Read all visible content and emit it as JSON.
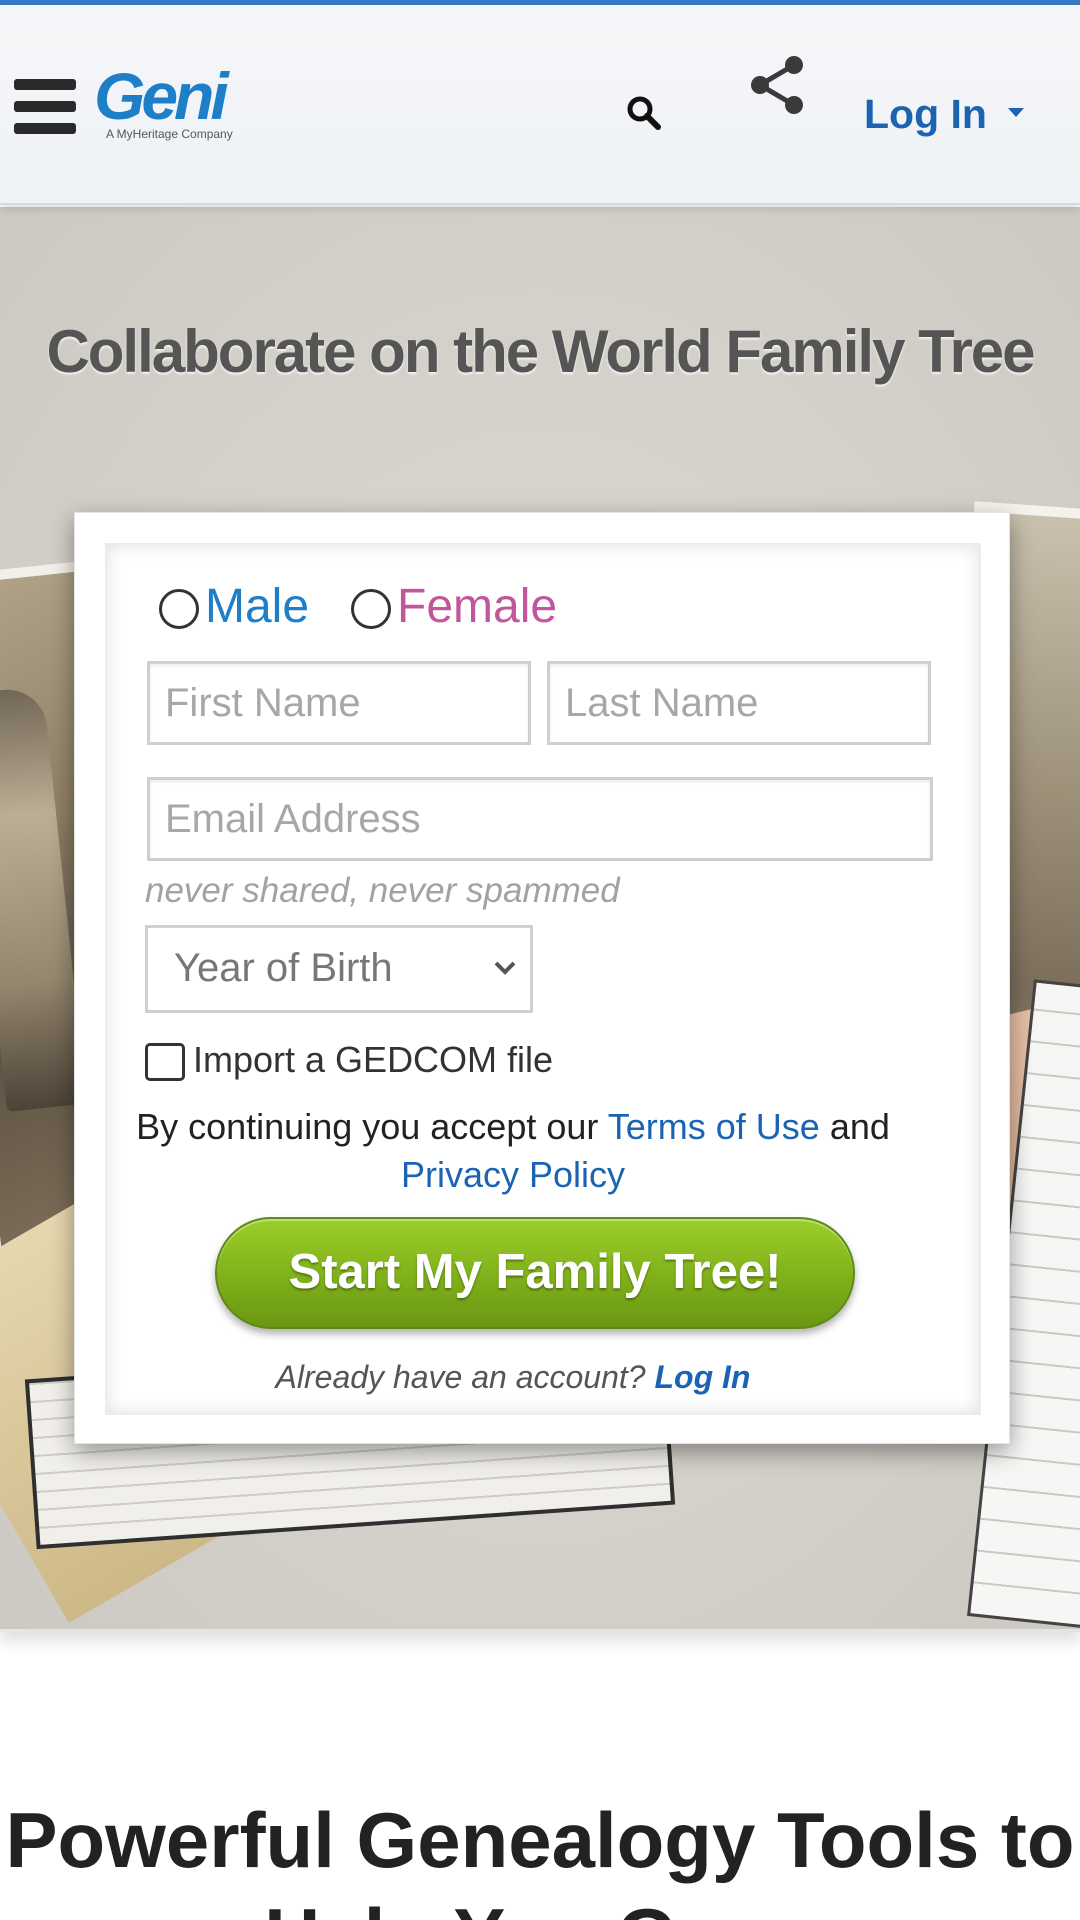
{
  "header": {
    "logo_text": "Geni",
    "logo_tagline": "A MyHeritage Company",
    "login_label": "Log In"
  },
  "hero": {
    "title": "Collaborate on the World Family Tree"
  },
  "signup": {
    "gender_male": "Male",
    "gender_female": "Female",
    "first_name_placeholder": "First Name",
    "last_name_placeholder": "Last Name",
    "email_placeholder": "Email Address",
    "email_note": "never shared, never spammed",
    "year_of_birth": "Year of Birth",
    "gedcom_label": "Import a GEDCOM file",
    "terms_prefix": "By continuing you accept our",
    "terms_link": "Terms of Use",
    "terms_and": "and",
    "privacy_link": "Privacy Policy",
    "submit_label": "Start My Family Tree!",
    "already_text": "Already have an account?",
    "already_login": "Log In"
  },
  "section": {
    "title": "Powerful Genealogy Tools to Help You Grow"
  },
  "colors": {
    "brand_blue": "#1e7fc8",
    "female_pink": "#c0579b",
    "cta_green": "#7fb01a",
    "link_blue": "#1b64b4"
  },
  "icons": [
    "menu-icon",
    "search-icon",
    "share-icon",
    "caret-down-icon",
    "chevron-down-icon"
  ]
}
